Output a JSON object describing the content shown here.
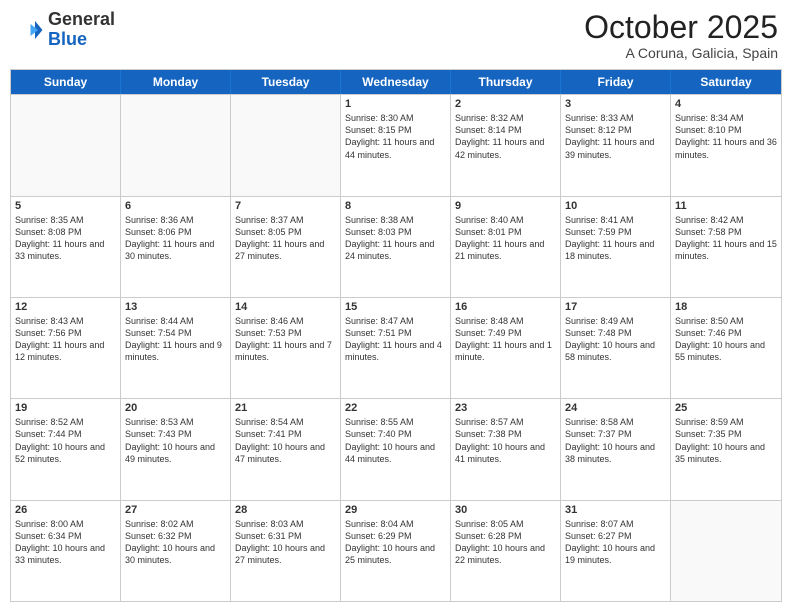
{
  "header": {
    "logo_general": "General",
    "logo_blue": "Blue",
    "month_title": "October 2025",
    "subtitle": "A Coruna, Galicia, Spain"
  },
  "calendar": {
    "days_of_week": [
      "Sunday",
      "Monday",
      "Tuesday",
      "Wednesday",
      "Thursday",
      "Friday",
      "Saturday"
    ],
    "rows": [
      [
        {
          "day": "",
          "empty": true
        },
        {
          "day": "",
          "empty": true
        },
        {
          "day": "",
          "empty": true
        },
        {
          "day": "1",
          "sunrise": "8:30 AM",
          "sunset": "8:15 PM",
          "daylight": "11 hours and 44 minutes."
        },
        {
          "day": "2",
          "sunrise": "8:32 AM",
          "sunset": "8:14 PM",
          "daylight": "11 hours and 42 minutes."
        },
        {
          "day": "3",
          "sunrise": "8:33 AM",
          "sunset": "8:12 PM",
          "daylight": "11 hours and 39 minutes."
        },
        {
          "day": "4",
          "sunrise": "8:34 AM",
          "sunset": "8:10 PM",
          "daylight": "11 hours and 36 minutes."
        }
      ],
      [
        {
          "day": "5",
          "sunrise": "8:35 AM",
          "sunset": "8:08 PM",
          "daylight": "11 hours and 33 minutes."
        },
        {
          "day": "6",
          "sunrise": "8:36 AM",
          "sunset": "8:06 PM",
          "daylight": "11 hours and 30 minutes."
        },
        {
          "day": "7",
          "sunrise": "8:37 AM",
          "sunset": "8:05 PM",
          "daylight": "11 hours and 27 minutes."
        },
        {
          "day": "8",
          "sunrise": "8:38 AM",
          "sunset": "8:03 PM",
          "daylight": "11 hours and 24 minutes."
        },
        {
          "day": "9",
          "sunrise": "8:40 AM",
          "sunset": "8:01 PM",
          "daylight": "11 hours and 21 minutes."
        },
        {
          "day": "10",
          "sunrise": "8:41 AM",
          "sunset": "7:59 PM",
          "daylight": "11 hours and 18 minutes."
        },
        {
          "day": "11",
          "sunrise": "8:42 AM",
          "sunset": "7:58 PM",
          "daylight": "11 hours and 15 minutes."
        }
      ],
      [
        {
          "day": "12",
          "sunrise": "8:43 AM",
          "sunset": "7:56 PM",
          "daylight": "11 hours and 12 minutes."
        },
        {
          "day": "13",
          "sunrise": "8:44 AM",
          "sunset": "7:54 PM",
          "daylight": "11 hours and 9 minutes."
        },
        {
          "day": "14",
          "sunrise": "8:46 AM",
          "sunset": "7:53 PM",
          "daylight": "11 hours and 7 minutes."
        },
        {
          "day": "15",
          "sunrise": "8:47 AM",
          "sunset": "7:51 PM",
          "daylight": "11 hours and 4 minutes."
        },
        {
          "day": "16",
          "sunrise": "8:48 AM",
          "sunset": "7:49 PM",
          "daylight": "11 hours and 1 minute."
        },
        {
          "day": "17",
          "sunrise": "8:49 AM",
          "sunset": "7:48 PM",
          "daylight": "10 hours and 58 minutes."
        },
        {
          "day": "18",
          "sunrise": "8:50 AM",
          "sunset": "7:46 PM",
          "daylight": "10 hours and 55 minutes."
        }
      ],
      [
        {
          "day": "19",
          "sunrise": "8:52 AM",
          "sunset": "7:44 PM",
          "daylight": "10 hours and 52 minutes."
        },
        {
          "day": "20",
          "sunrise": "8:53 AM",
          "sunset": "7:43 PM",
          "daylight": "10 hours and 49 minutes."
        },
        {
          "day": "21",
          "sunrise": "8:54 AM",
          "sunset": "7:41 PM",
          "daylight": "10 hours and 47 minutes."
        },
        {
          "day": "22",
          "sunrise": "8:55 AM",
          "sunset": "7:40 PM",
          "daylight": "10 hours and 44 minutes."
        },
        {
          "day": "23",
          "sunrise": "8:57 AM",
          "sunset": "7:38 PM",
          "daylight": "10 hours and 41 minutes."
        },
        {
          "day": "24",
          "sunrise": "8:58 AM",
          "sunset": "7:37 PM",
          "daylight": "10 hours and 38 minutes."
        },
        {
          "day": "25",
          "sunrise": "8:59 AM",
          "sunset": "7:35 PM",
          "daylight": "10 hours and 35 minutes."
        }
      ],
      [
        {
          "day": "26",
          "sunrise": "8:00 AM",
          "sunset": "6:34 PM",
          "daylight": "10 hours and 33 minutes."
        },
        {
          "day": "27",
          "sunrise": "8:02 AM",
          "sunset": "6:32 PM",
          "daylight": "10 hours and 30 minutes."
        },
        {
          "day": "28",
          "sunrise": "8:03 AM",
          "sunset": "6:31 PM",
          "daylight": "10 hours and 27 minutes."
        },
        {
          "day": "29",
          "sunrise": "8:04 AM",
          "sunset": "6:29 PM",
          "daylight": "10 hours and 25 minutes."
        },
        {
          "day": "30",
          "sunrise": "8:05 AM",
          "sunset": "6:28 PM",
          "daylight": "10 hours and 22 minutes."
        },
        {
          "day": "31",
          "sunrise": "8:07 AM",
          "sunset": "6:27 PM",
          "daylight": "10 hours and 19 minutes."
        },
        {
          "day": "",
          "empty": true
        }
      ]
    ]
  }
}
